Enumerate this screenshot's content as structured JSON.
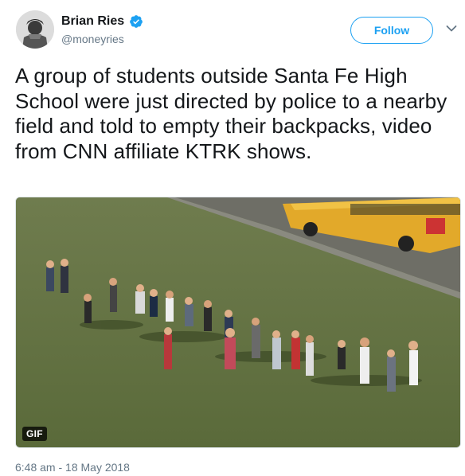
{
  "tweet": {
    "author": {
      "display_name": "Brian Ries",
      "handle": "@moneyries",
      "verified_icon": "verified-badge-icon",
      "avatar": "avatar"
    },
    "follow_label": "Follow",
    "more_icon": "chevron-down-icon",
    "text": "A group of students outside Santa Fe High School were just directed by police to a nearby field and told to empty their backpacks, video from CNN affiliate KTRK shows.",
    "media": {
      "badge": "GIF"
    },
    "timestamp": "6:48 am - 18 May 2018"
  },
  "colors": {
    "accent": "#1da1f2",
    "text": "#14171a",
    "muted": "#657786"
  }
}
